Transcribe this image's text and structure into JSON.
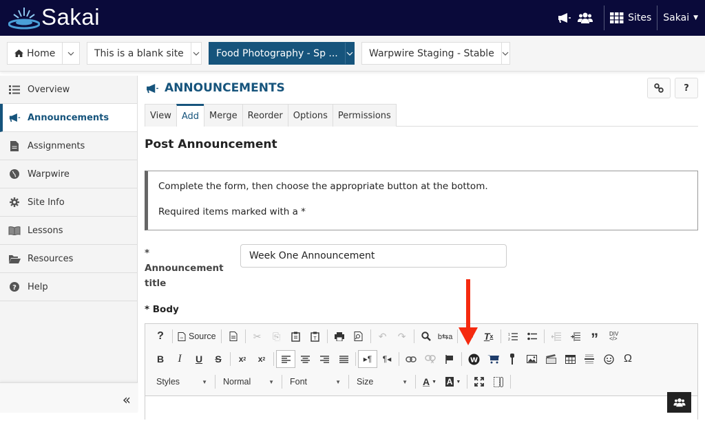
{
  "header": {
    "brand": "Sakai",
    "notifications_icon": "bullhorn-icon",
    "roster_icon": "users-icon",
    "sites_label": "Sites",
    "user_label": "Sakai"
  },
  "site_tabs": [
    {
      "label": "Home",
      "icon": "home-icon",
      "active": false
    },
    {
      "label": "This is a blank site",
      "active": false
    },
    {
      "label": "Food Photography - Sp ...",
      "active": true
    },
    {
      "label": "Warpwire Staging - Stable",
      "active": false
    }
  ],
  "sidebar": {
    "items": [
      {
        "label": "Overview",
        "icon": "list-icon"
      },
      {
        "label": "Announcements",
        "icon": "bullhorn-icon",
        "active": true
      },
      {
        "label": "Assignments",
        "icon": "file-icon"
      },
      {
        "label": "Warpwire",
        "icon": "globe-icon"
      },
      {
        "label": "Site Info",
        "icon": "gear-icon"
      },
      {
        "label": "Lessons",
        "icon": "book-icon"
      },
      {
        "label": "Resources",
        "icon": "folder-open-icon"
      },
      {
        "label": "Help",
        "icon": "question-circle-icon"
      }
    ],
    "collapse_label": "«"
  },
  "main": {
    "title": "ANNOUNCEMENTS",
    "link_button": "link-icon",
    "help_button": "?",
    "tabs": [
      {
        "label": "View"
      },
      {
        "label": "Add",
        "active": true
      },
      {
        "label": "Merge"
      },
      {
        "label": "Reorder"
      },
      {
        "label": "Options"
      },
      {
        "label": "Permissions"
      }
    ],
    "subtitle": "Post Announcement",
    "instructions": [
      "Complete the form, then choose the appropriate button at the bottom.",
      "Required items marked with a *"
    ],
    "title_field": {
      "label_star": "*",
      "label_line1": "Announcement",
      "label_line2": "title",
      "value": "Week One Announcement"
    },
    "body_label": "* Body",
    "editor": {
      "source_label": "Source",
      "combos": [
        "Styles",
        "Normal",
        "Font",
        "Size"
      ]
    }
  },
  "annotation_color": "#f52a0f",
  "brand_color": "#16547c"
}
